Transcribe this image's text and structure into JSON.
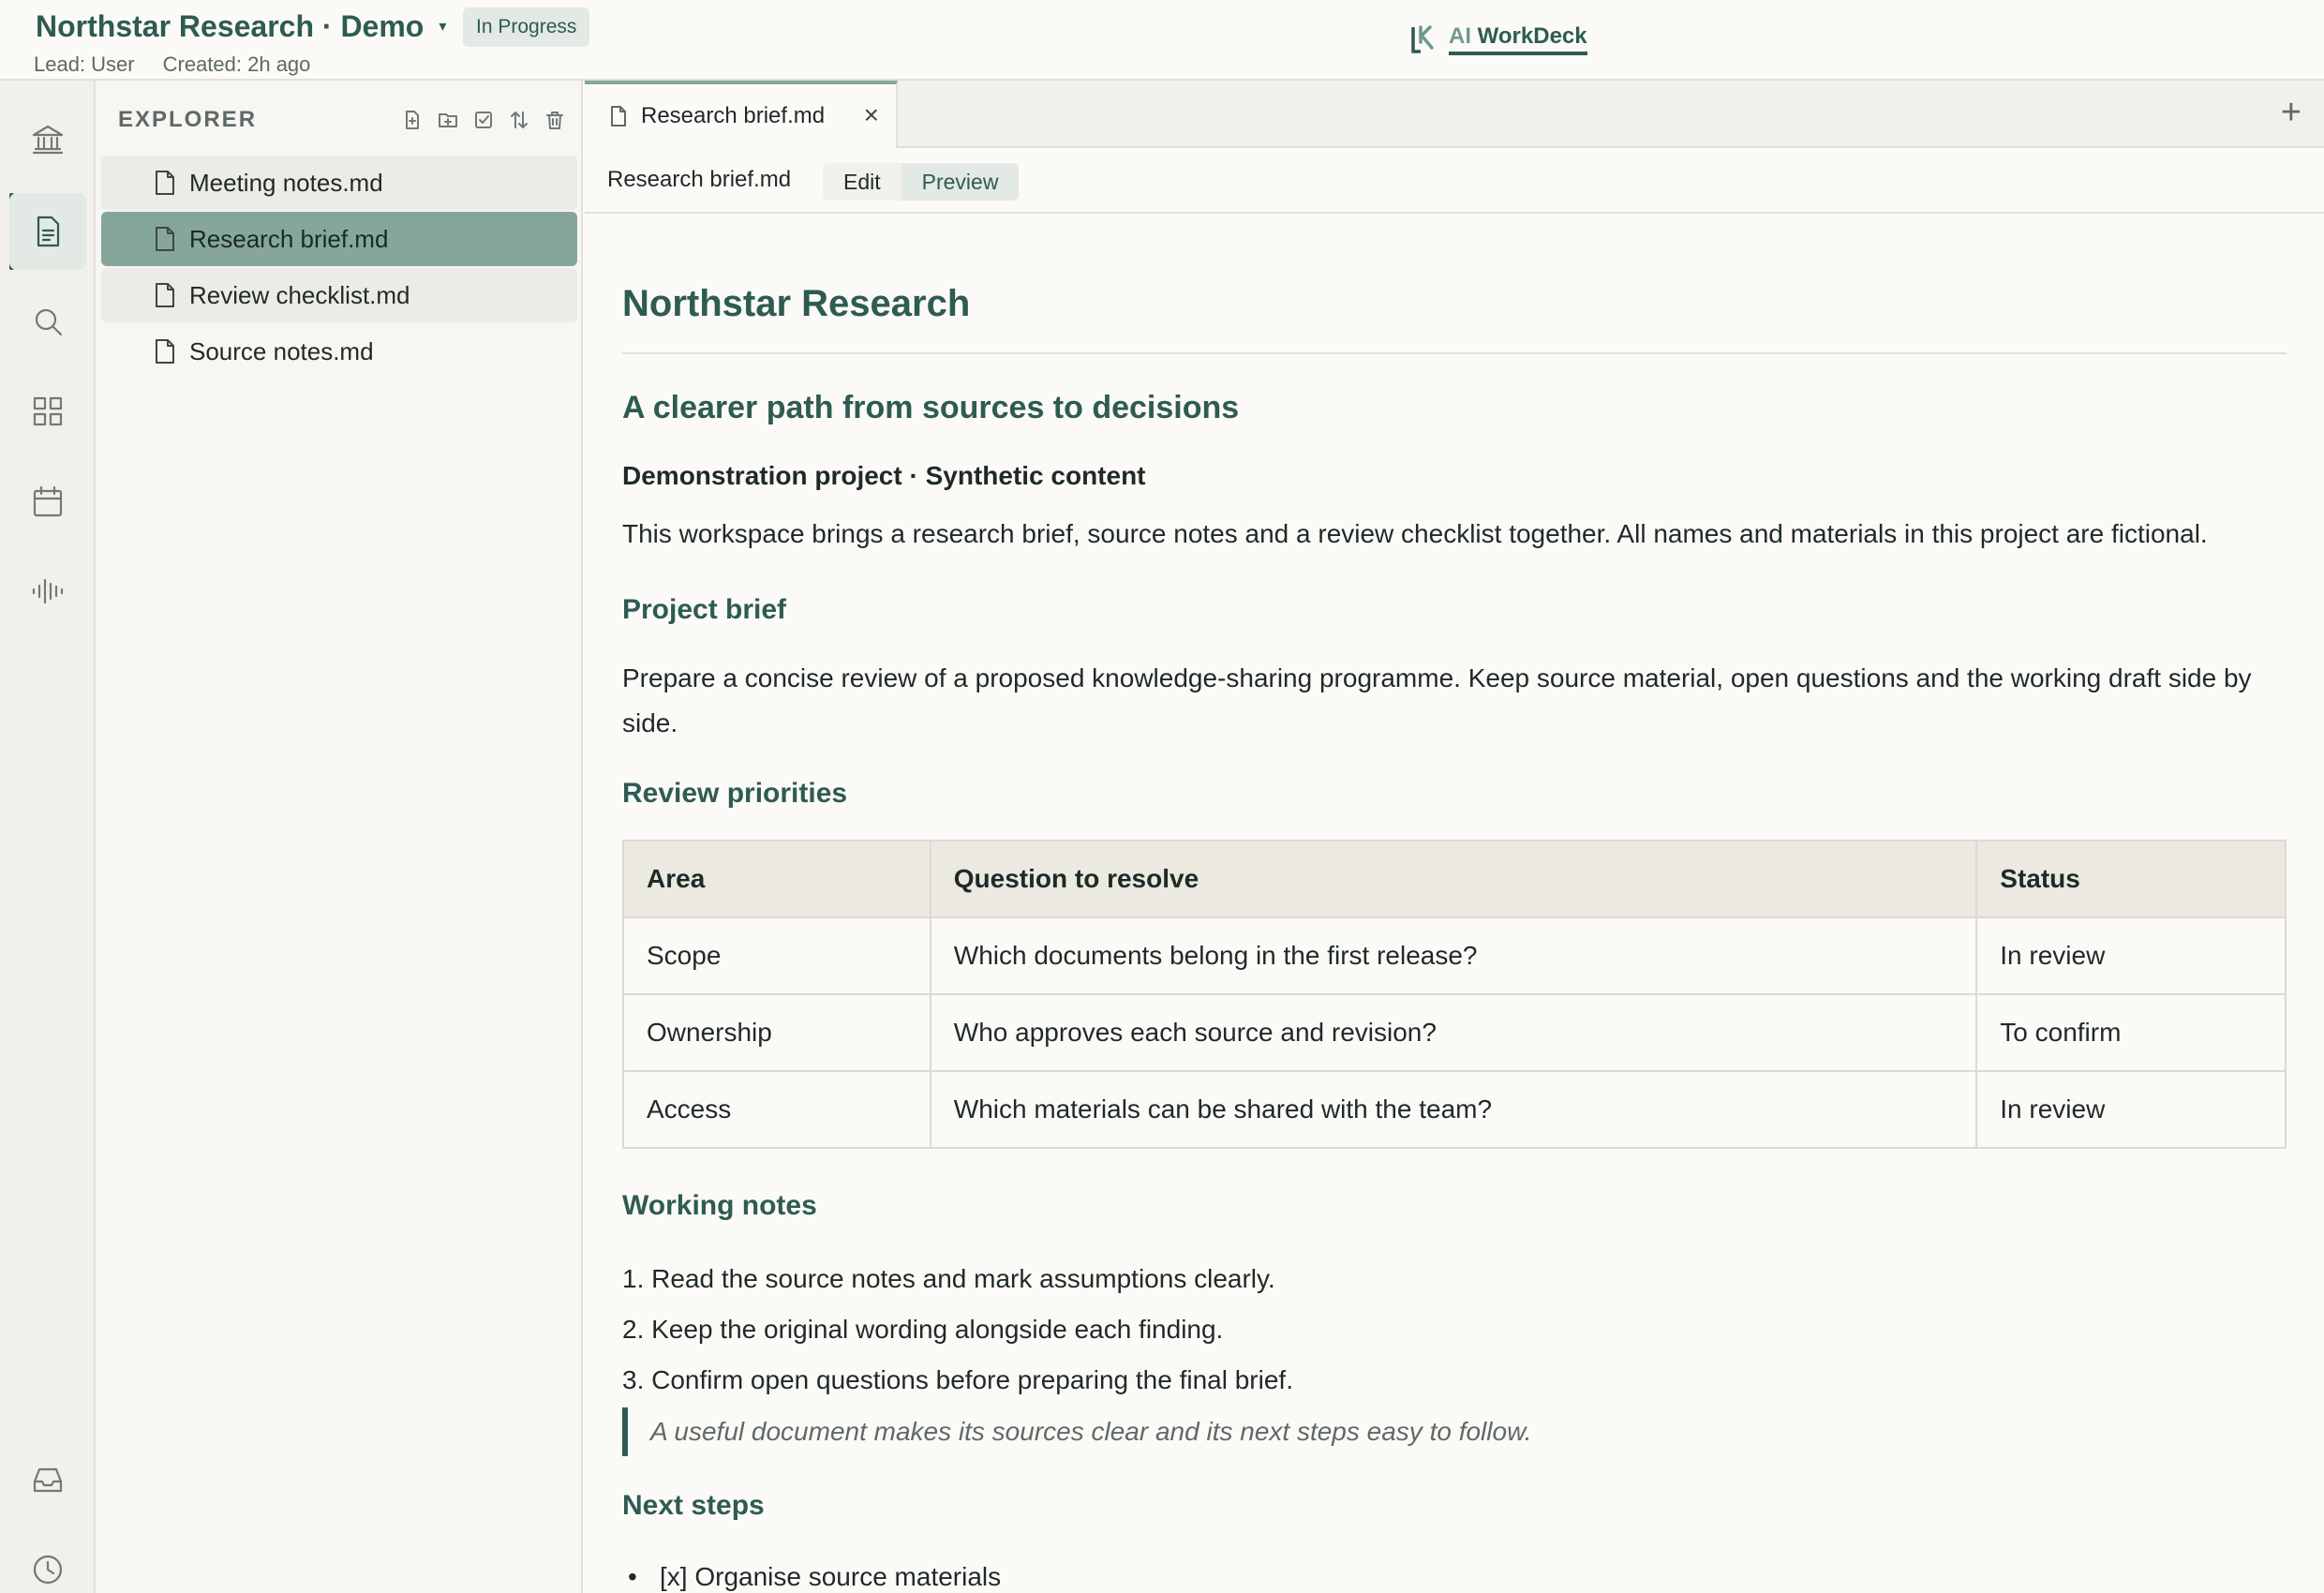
{
  "header": {
    "project_title": "Northstar Research · Demo",
    "caret": "▾",
    "status": "In Progress",
    "lead": "Lead: User",
    "created": "Created: 2h ago",
    "brand_ai": "AI",
    "brand_name": "WorkDeck"
  },
  "activity_bar": {
    "items": [
      "bank-icon",
      "document-icon",
      "search-icon",
      "dashboard-icon",
      "calendar-icon",
      "waveform-icon",
      "inbox-icon",
      "clock-icon"
    ],
    "active": "document-icon"
  },
  "explorer": {
    "title": "EXPLORER",
    "tools": [
      "new-file-icon",
      "new-folder-icon",
      "checklist-icon",
      "sort-icon",
      "trash-icon"
    ],
    "files": [
      {
        "name": "Meeting notes.md"
      },
      {
        "name": "Research brief.md",
        "selected": true
      },
      {
        "name": "Review checklist.md"
      },
      {
        "name": "Source notes.md"
      }
    ]
  },
  "editor": {
    "tab_label": "Research brief.md",
    "tab_close": "×",
    "tab_add": "+",
    "doc_name": "Research brief.md",
    "modes": {
      "edit": "Edit",
      "preview": "Preview"
    },
    "active_mode": "Preview"
  },
  "document": {
    "h1": "Northstar Research",
    "h2": "A clearer path from sources to decisions",
    "subtitle": "Demonstration project · Synthetic content",
    "intro": "This workspace brings a research brief, source notes and a review checklist together. All names and materials in this project are fictional.",
    "brief_heading": "Project brief",
    "brief_text": "Prepare a concise review of a proposed knowledge-sharing programme. Keep source material, open questions and the working draft side by side.",
    "priorities_heading": "Review priorities",
    "table": {
      "headers": [
        "Area",
        "Question to resolve",
        "Status"
      ],
      "rows": [
        [
          "Scope",
          "Which documents belong in the first release?",
          "In review"
        ],
        [
          "Ownership",
          "Who approves each source and revision?",
          "To confirm"
        ],
        [
          "Access",
          "Which materials can be shared with the team?",
          "In review"
        ]
      ]
    },
    "notes_heading": "Working notes",
    "notes": [
      "1. Read the source notes and mark assumptions clearly.",
      "2. Keep the original wording alongside each finding.",
      "3. Confirm open questions before preparing the final brief."
    ],
    "quote": "A useful document makes its sources clear and its next steps easy to follow.",
    "next_heading": "Next steps",
    "next_steps": [
      "[x] Organise source materials"
    ]
  },
  "colors": {
    "accent": "#2e5b52",
    "selected_file": "#86a69c",
    "status_pill_bg": "#e3e9e4",
    "table_header_bg": "#ebe9e0",
    "page_bg": "#fbfaf7"
  }
}
